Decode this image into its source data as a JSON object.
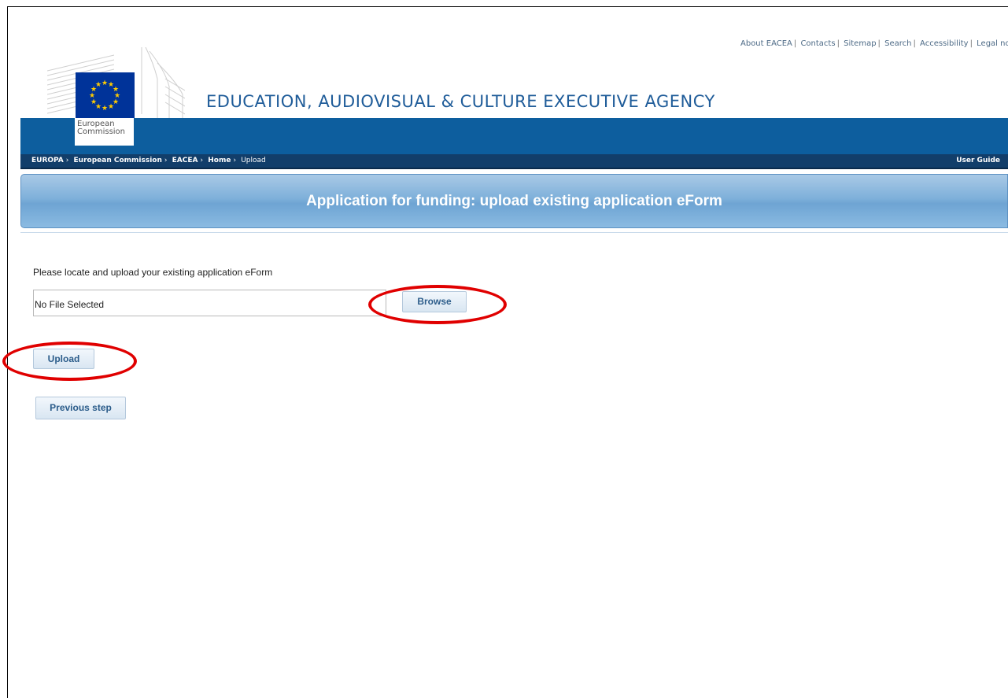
{
  "header": {
    "top_links": [
      "About EACEA",
      "Contacts",
      "Sitemap",
      "Search",
      "Accessibility",
      "Legal notice"
    ],
    "agency_title": "EDUCATION, AUDIOVISUAL & CULTURE EXECUTIVE AGENCY",
    "logo_text_line1": "European",
    "logo_text_line2": "Commission"
  },
  "breadcrumb": {
    "items": [
      "EUROPA",
      "European Commission",
      "EACEA",
      "Home"
    ],
    "current": "Upload",
    "separator": "›",
    "user_guide": "User Guide"
  },
  "banner": {
    "title": "Application for funding: upload existing application eForm"
  },
  "form": {
    "instruction": "Please locate and upload your existing application eForm",
    "file_value": "No File Selected",
    "browse_label": "Browse",
    "upload_label": "Upload",
    "previous_label": "Previous step"
  },
  "colors": {
    "band_blue": "#0d5e9e",
    "crumb_bar": "#123e6a",
    "title_blue": "#1f5c99",
    "highlight_red": "#e00000"
  }
}
